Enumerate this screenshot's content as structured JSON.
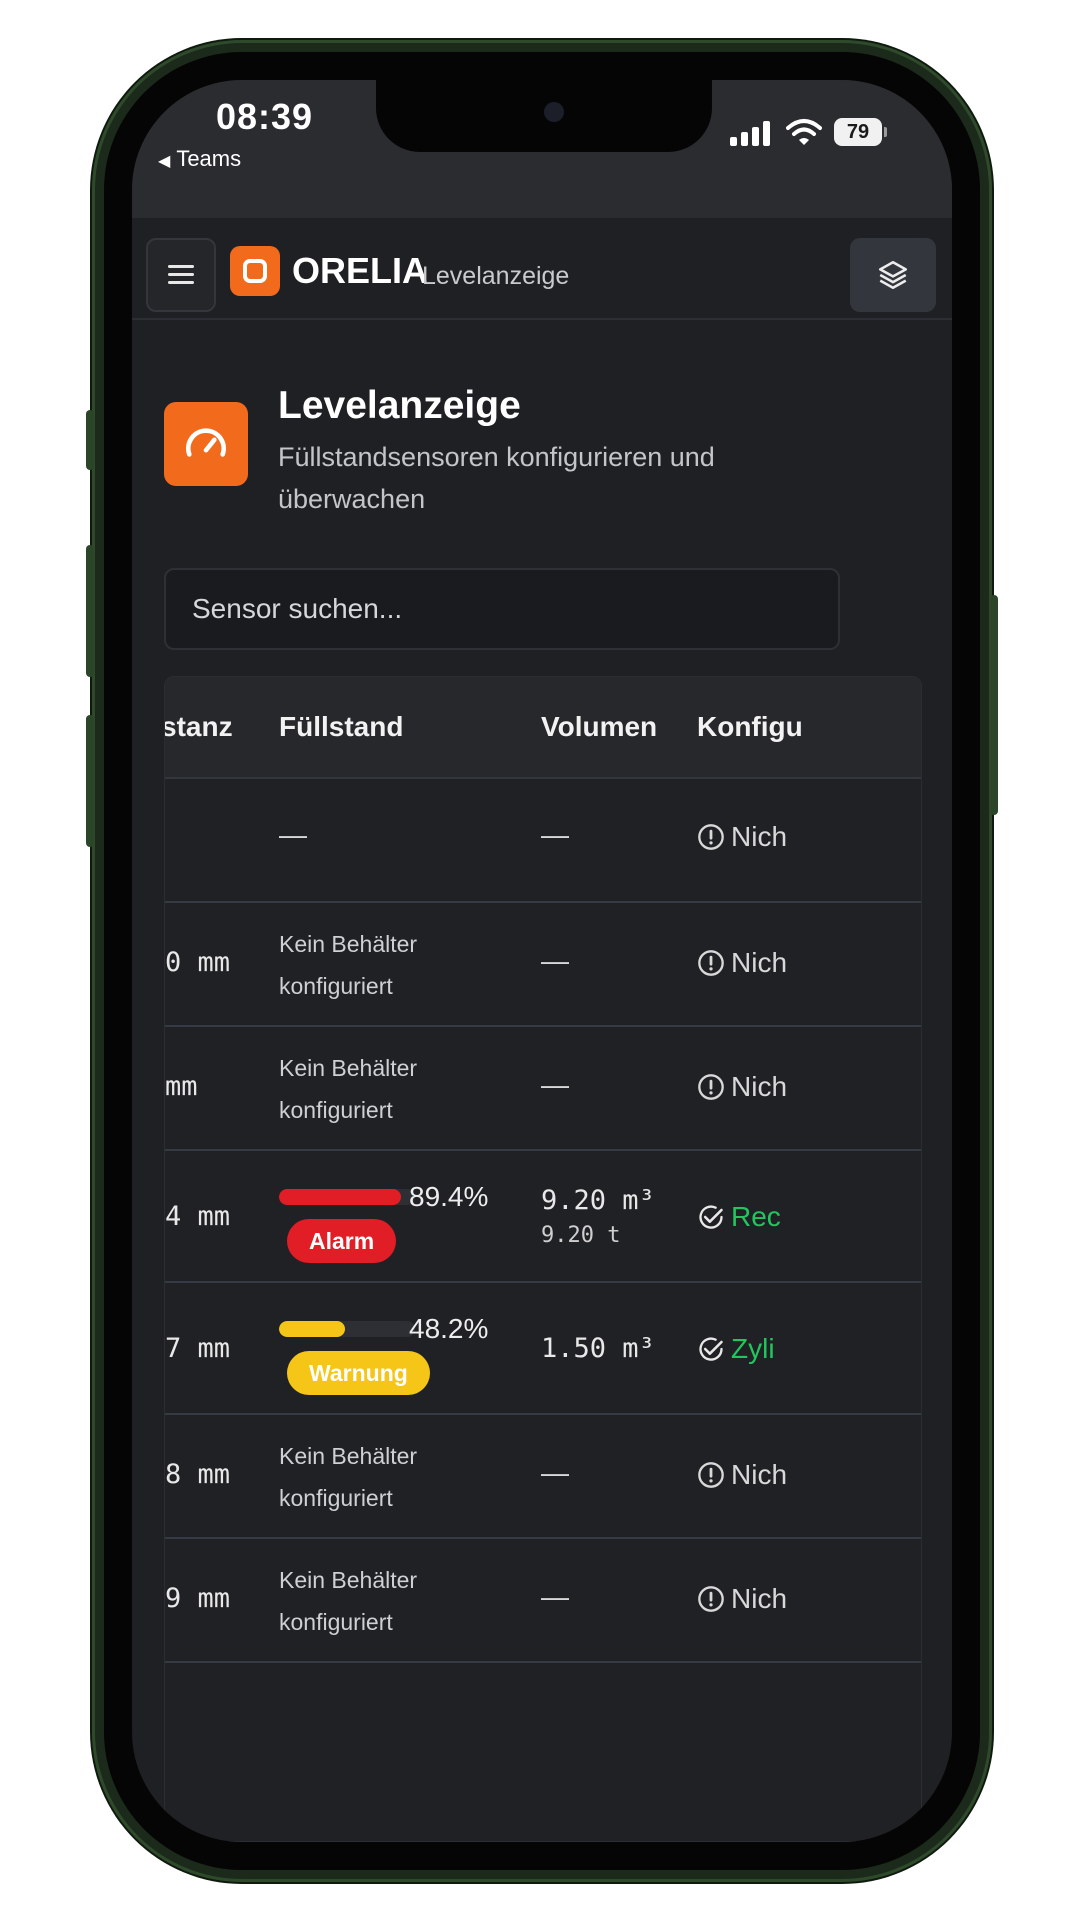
{
  "status_bar": {
    "time": "08:39",
    "back_app": "Teams",
    "battery": "79"
  },
  "header": {
    "brand": "ORELIA",
    "subtitle": "Levelanzeige",
    "menu_icon": "hamburger-icon",
    "layers_icon": "layers-icon"
  },
  "page": {
    "title": "Levelanzeige",
    "description": "Füllstandsensoren konfigurieren und überwachen",
    "icon": "gauge-icon"
  },
  "search": {
    "placeholder": "Sensor suchen..."
  },
  "table": {
    "columns": [
      "stanz",
      "Füllstand",
      "Volumen",
      "Konfigu"
    ],
    "rows": [
      {
        "distance": "",
        "fill_text": "—",
        "volume": "—",
        "config": "Nich"
      },
      {
        "distance": "0 mm",
        "fill_text": "Kein Behälter konfiguriert",
        "volume": "—",
        "config": "Nich"
      },
      {
        "distance": "mm",
        "fill_text": "Kein Behälter konfiguriert",
        "volume": "—",
        "config": "Nich"
      },
      {
        "distance": "4 mm",
        "fill_pct": "89.4%",
        "fill_value": 89.4,
        "badge": "Alarm",
        "volume": "9.20 m³",
        "volume_sub": "9.20 t",
        "config": "Rec"
      },
      {
        "distance": "7 mm",
        "fill_pct": "48.2%",
        "fill_value": 48.2,
        "badge": "Warnung",
        "volume": "1.50 m³",
        "config": "Zyli"
      },
      {
        "distance": "8 mm",
        "fill_text": "Kein Behälter konfiguriert",
        "volume": "—",
        "config": "Nich"
      },
      {
        "distance": "9 mm",
        "fill_text": "Kein Behälter konfiguriert",
        "volume": "—",
        "config": "Nich"
      }
    ]
  },
  "colors": {
    "accent": "#f26b1d",
    "alarm": "#e11d26",
    "warning": "#f5c518",
    "ok": "#22c55e"
  }
}
